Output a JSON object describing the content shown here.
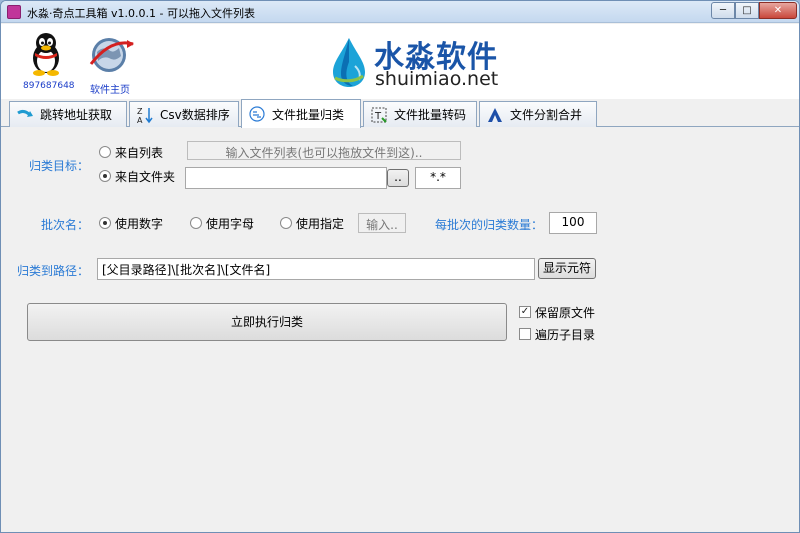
{
  "window": {
    "title": "水淼·奇点工具箱 v1.0.0.1 - 可以拖入文件列表",
    "min_icon": "minimize-icon",
    "max_icon": "maximize-icon",
    "close_icon": "close-icon"
  },
  "header": {
    "qq_number": "897687648",
    "home_label": "软件主页",
    "brand_name": "水淼软件",
    "brand_url": "shuimiao.net"
  },
  "tabs": [
    {
      "label": "跳转地址获取",
      "icon": "redirect-arrow-icon"
    },
    {
      "label": "Csv数据排序",
      "icon": "sort-az-icon"
    },
    {
      "label": "文件批量归类",
      "icon": "classify-icon"
    },
    {
      "label": "文件批量转码",
      "icon": "transcode-icon"
    },
    {
      "label": "文件分割合并",
      "icon": "split-merge-icon"
    }
  ],
  "active_tab": "文件批量归类",
  "form": {
    "target_label": "归类目标：",
    "from_list_label": "来自列表",
    "from_list_placeholder": "输入文件列表(也可以拖放文件到这)..",
    "from_folder_label": "来自文件夹",
    "folder_value": "",
    "browse_label": "..",
    "pattern_value": "*.*",
    "batch_name_label": "批次名：",
    "use_number_label": "使用数字",
    "use_letter_label": "使用字母",
    "use_custom_label": "使用指定",
    "custom_input_placeholder": "输入..",
    "batch_count_label": "每批次的归类数量：",
    "batch_count_value": "100",
    "path_label": "归类到路径：",
    "path_value": "[父目录路径]\\[批次名]\\[文件名]",
    "show_tokens_label": "显示元符",
    "execute_label": "立即执行归类",
    "keep_original_label": "保留原文件",
    "keep_original_checked": true,
    "recurse_label": "遍历子目录",
    "recurse_checked": false,
    "target_selected": "来自文件夹",
    "batch_selected": "使用数字"
  },
  "colors": {
    "label_blue": "#2b7bd5",
    "brand_blue": "#1a55a8",
    "link_blue": "#1a3cc8"
  }
}
